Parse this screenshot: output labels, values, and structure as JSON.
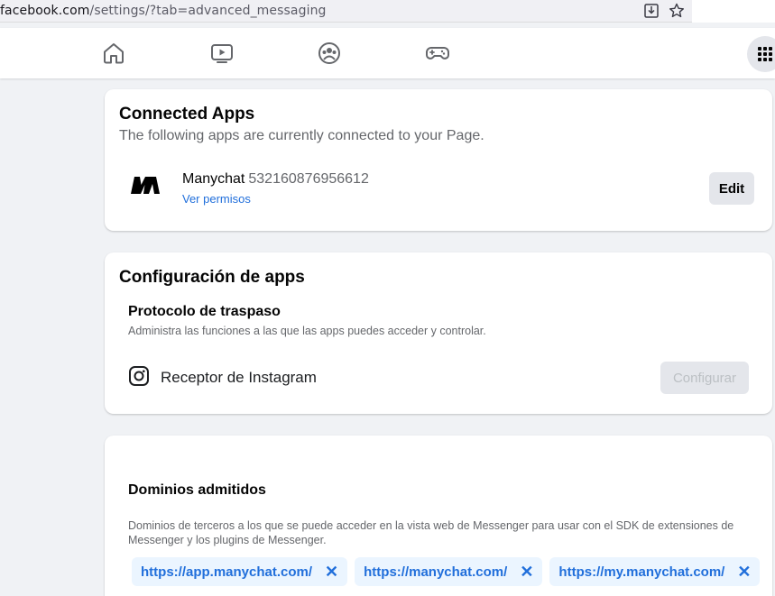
{
  "browser": {
    "url_host": "facebook.com",
    "url_path": "/settings/?tab=advanced_messaging"
  },
  "connected_apps": {
    "title": "Connected Apps",
    "subtitle": "The following apps are currently connected to your Page.",
    "app": {
      "name": "Manychat",
      "id": "532160876956612",
      "link": "Ver permisos",
      "button": "Edit"
    }
  },
  "app_config": {
    "title": "Configuración de apps",
    "section_title": "Protocolo de traspaso",
    "section_desc": "Administra las funciones a las que las apps puedes acceder y controlar.",
    "receiver_label": "Receptor de Instagram",
    "button": "Configurar"
  },
  "domains": {
    "title": "Dominios admitidos",
    "desc": "Dominios de terceros a los que se puede acceder en la vista web de Messenger para usar con el SDK de extensiones de Messenger y los plugins de Messenger.",
    "items": [
      {
        "label": "https://app.manychat.com/"
      },
      {
        "label": "https://manychat.com/"
      },
      {
        "label": "https://my.manychat.com/"
      }
    ],
    "remove_glyph": "✕"
  },
  "colors": {
    "accent": "#216fdb",
    "chip_bg": "#ebf5ff",
    "page_bg": "#f0f2f5"
  }
}
